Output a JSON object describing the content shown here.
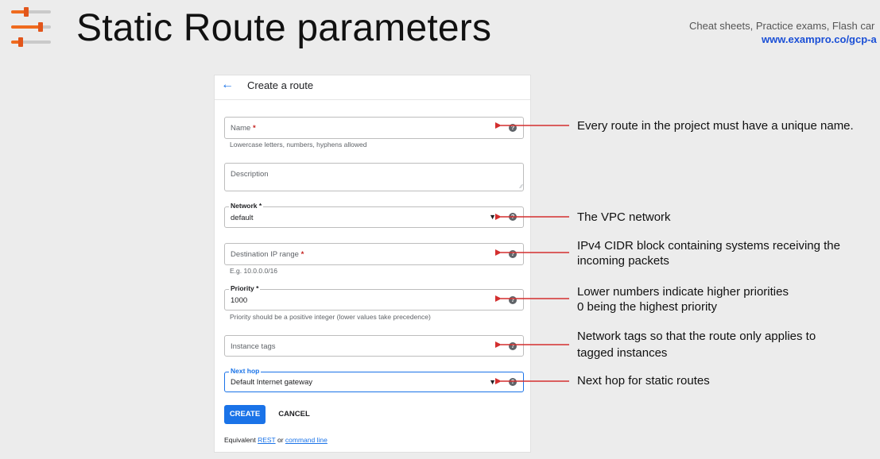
{
  "slide": {
    "title": "Static Route parameters",
    "brand_line1": "Cheat sheets, Practice exams, Flash car",
    "brand_line2": "www.exampro.co/gcp-a"
  },
  "form": {
    "header_title": "Create a route",
    "fields": {
      "name": {
        "label": "Name",
        "required_mark": "*",
        "hint": "Lowercase letters, numbers, hyphens allowed"
      },
      "description": {
        "label": "Description"
      },
      "network": {
        "label": "Network *",
        "value": "default"
      },
      "destination": {
        "label": "Destination IP range",
        "required_mark": "*",
        "hint": "E.g. 10.0.0.0/16"
      },
      "priority": {
        "label": "Priority *",
        "value": "1000",
        "hint": "Priority should be a positive integer (lower values take precedence)"
      },
      "instance_tags": {
        "label": "Instance tags"
      },
      "next_hop": {
        "label": "Next hop",
        "value": "Default Internet gateway"
      }
    },
    "buttons": {
      "create": "CREATE",
      "cancel": "CANCEL"
    },
    "footer": {
      "prefix": "Equivalent",
      "rest": "REST",
      "or": "or",
      "command_line": "command line"
    }
  },
  "annotations": {
    "name": [
      "Every route in the project must have a unique name."
    ],
    "network": [
      "The VPC network"
    ],
    "destination": [
      "IPv4 CIDR block containing systems receiving the",
      "incoming packets"
    ],
    "priority": [
      "Lower numbers indicate higher priorities",
      "0 being the highest priority"
    ],
    "instance_tags": [
      "Network tags so that the route only applies to",
      "tagged instances"
    ],
    "next_hop": [
      "Next hop for static routes"
    ]
  },
  "icons": {
    "back": "arrow-left",
    "help": "question-circle",
    "dropdown": "caret-down"
  },
  "colors": {
    "accent": "#1a73e8",
    "annotation_arrow": "#d32f2f",
    "logo_orange": "#ef6b1f",
    "brand_blue": "#1a4fd6"
  }
}
